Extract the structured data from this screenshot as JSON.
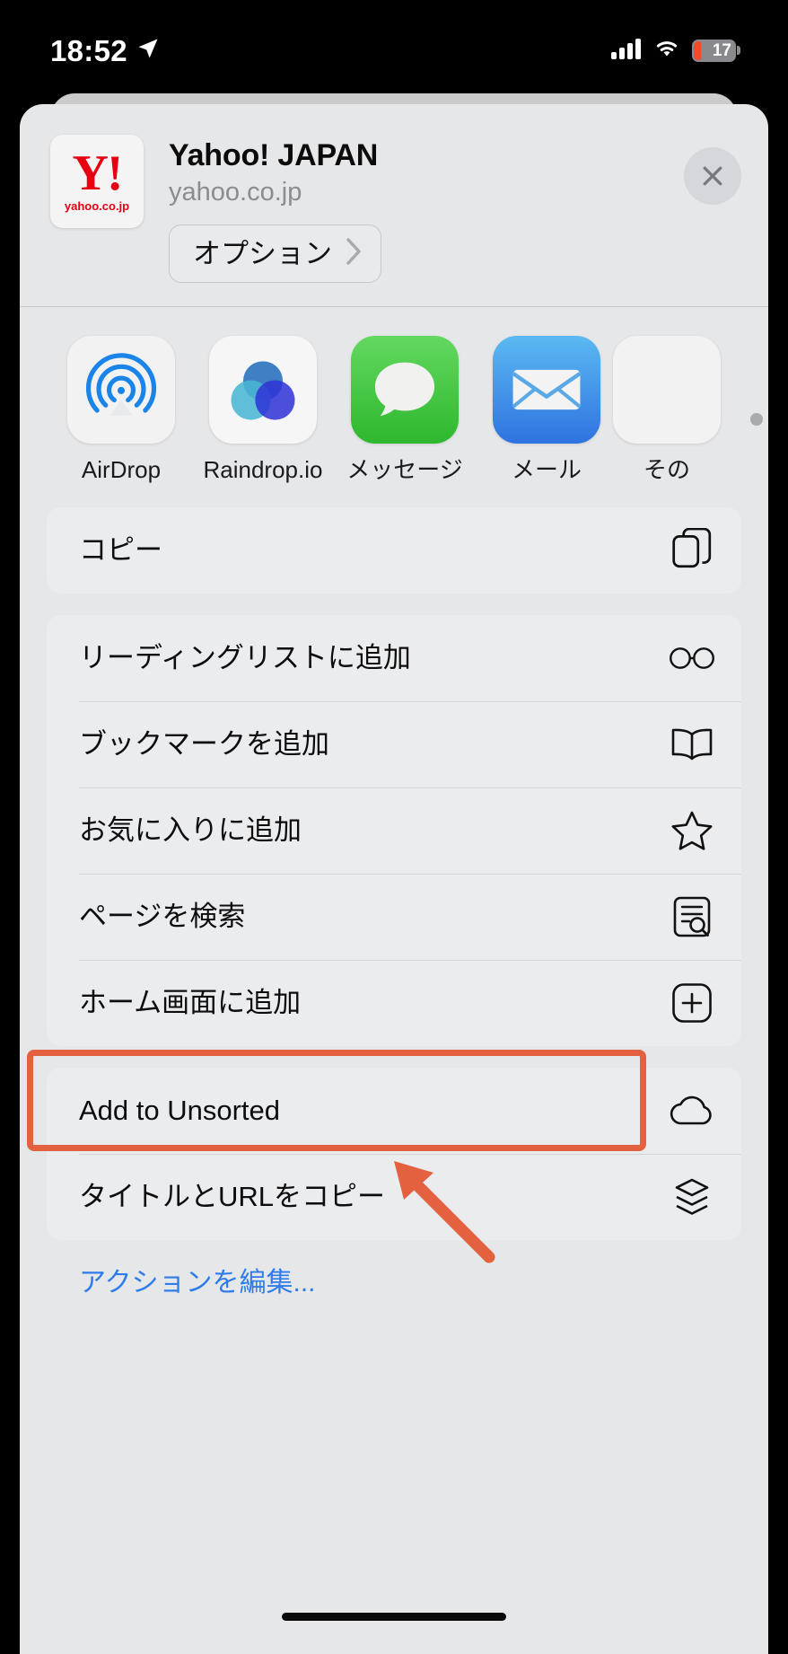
{
  "status_bar": {
    "time": "18:52",
    "location_icon": "location-arrow-icon",
    "cellular_icon": "cellular-bars-icon",
    "wifi_icon": "wifi-icon",
    "battery_percent": "17",
    "battery_color": "#f6482f"
  },
  "sheet": {
    "header": {
      "favicon_letter": "Y!",
      "favicon_domain": "yahoo.co.jp",
      "title": "Yahoo! JAPAN",
      "url": "yahoo.co.jp",
      "options_label": "オプション",
      "close_label": "×"
    },
    "apps": [
      {
        "label": "AirDrop",
        "icon": "airdrop-icon"
      },
      {
        "label": "Raindrop.io",
        "icon": "raindrop-icon"
      },
      {
        "label": "メッセージ",
        "icon": "messages-icon"
      },
      {
        "label": "メール",
        "icon": "mail-icon"
      },
      {
        "label": "その",
        "icon": "more-icon"
      }
    ],
    "groups": [
      {
        "rows": [
          {
            "label": "コピー",
            "icon": "copy-icon"
          }
        ]
      },
      {
        "rows": [
          {
            "label": "リーディングリストに追加",
            "icon": "glasses-icon"
          },
          {
            "label": "ブックマークを追加",
            "icon": "book-icon"
          },
          {
            "label": "お気に入りに追加",
            "icon": "star-icon"
          },
          {
            "label": "ページを検索",
            "icon": "find-page-icon"
          },
          {
            "label": "ホーム画面に追加",
            "icon": "add-to-home-icon"
          }
        ]
      },
      {
        "rows": [
          {
            "label": "Add to Unsorted",
            "icon": "cloud-icon"
          },
          {
            "label": "タイトルとURLをコピー",
            "icon": "layers-icon",
            "highlighted": true
          }
        ]
      }
    ],
    "edit_actions_label": "アクションを編集...",
    "accent_link_color": "#2f7ceb"
  },
  "annotation": {
    "color": "#e4613f",
    "highlight_target": "タイトルとURLをコピー"
  }
}
